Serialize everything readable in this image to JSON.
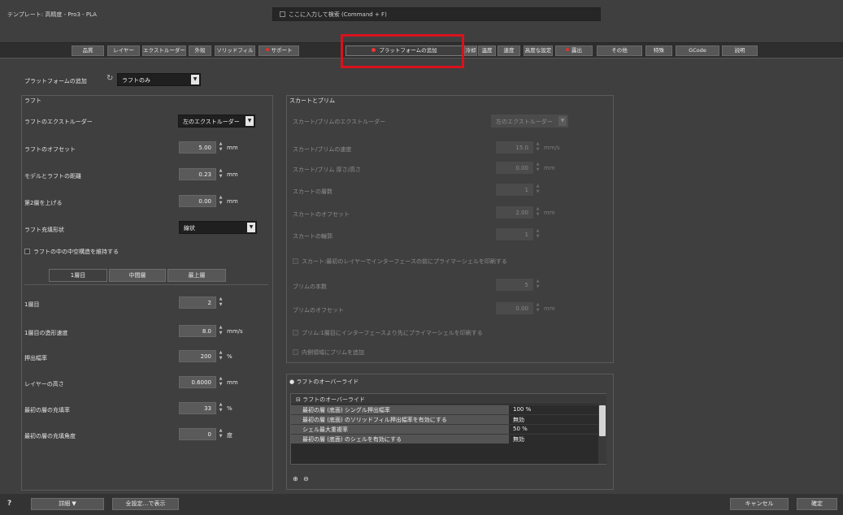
{
  "window": {
    "title": "テンプレート: 高精度 - Pro3 - PLA",
    "search_placeholder": "ここに入力して検索 (Command + F)"
  },
  "tabs": [
    {
      "label": "品質",
      "warn": false,
      "active": false
    },
    {
      "label": "レイヤー",
      "warn": false,
      "active": false
    },
    {
      "label": "エクストルーダー",
      "warn": false,
      "active": false
    },
    {
      "label": "外殻",
      "warn": false,
      "active": false
    },
    {
      "label": "ソリッドフィル",
      "warn": false,
      "active": false
    },
    {
      "label": "サポート",
      "warn": true,
      "active": false
    },
    {
      "label": "プラットフォームの追加",
      "warn": false,
      "active": true
    },
    {
      "label": "冷却",
      "warn": false,
      "active": false
    },
    {
      "label": "温度",
      "warn": false,
      "active": false
    },
    {
      "label": "速度",
      "warn": false,
      "active": false
    },
    {
      "label": "高度な設定",
      "warn": false,
      "active": false
    },
    {
      "label": "露出",
      "warn": true,
      "active": false
    },
    {
      "label": "その他",
      "warn": false,
      "active": false
    },
    {
      "label": "特殊",
      "warn": false,
      "active": false
    },
    {
      "label": "GCode",
      "warn": false,
      "active": false
    },
    {
      "label": "説明",
      "warn": false,
      "active": false
    }
  ],
  "platform": {
    "label": "プラットフォームの追加",
    "value": "ラフトのみ"
  },
  "raft": {
    "group_title": "ラフト",
    "extruder_label": "ラフトのエクストルーダー",
    "extruder_value": "左のエクストルーダー",
    "offset_label": "ラフトのオフセット",
    "offset_value": "5.00",
    "offset_unit": "mm",
    "separation_label": "モデルとラフトの距離",
    "separation_value": "0.23",
    "separation_unit": "mm",
    "raise_label": "第2層を上げる",
    "raise_value": "0.00",
    "raise_unit": "mm",
    "infill_label": "ラフト充填形状",
    "infill_value": "線状",
    "checkbox_label": "ラフトの中の中空構造を維持する",
    "subtabs": [
      "1層目",
      "中間層",
      "最上層"
    ],
    "layer1_label": "1層目",
    "layer1_value": "2",
    "speed_label": "1層目の造形速度",
    "speed_value": "8.0",
    "speed_unit": "mm/s",
    "extrusion_label": "押出幅率",
    "extrusion_value": "200",
    "extrusion_unit": "%",
    "height_label": "レイヤーの高さ",
    "height_value": "0.6000",
    "height_unit": "mm",
    "infill_pct_label": "最初の層の充填率",
    "infill_pct_value": "33",
    "infill_pct_unit": "%",
    "infill_angle_label": "最初の層の充填角度",
    "infill_angle_value": "0",
    "infill_angle_unit": "度"
  },
  "skirt": {
    "group_title": "スカートとブリム",
    "extruder_label": "スカート/ブリムのエクストルーダー",
    "extruder_value": "左のエクストルーダー",
    "speed_label": "スカート/ブリムの速度",
    "speed_value": "15.0",
    "speed_unit": "mm/s",
    "height_label": "スカート/ブリム 厚さ/高さ",
    "height_value": "0.00",
    "height_unit": "mm",
    "layers_label": "スカートの層数",
    "layers_value": "1",
    "offset_label": "スカートのオフセット",
    "offset_value": "2.00",
    "offset_unit": "mm",
    "outlines_label": "スカートの輪郭",
    "outlines_value": "1",
    "check1_label": "スカート:最初のレイヤーでインターフェースの前にプライマーシェルを印刷する",
    "brim_width_label": "ブリムの本数",
    "brim_width_value": "5",
    "brim_offset_label": "ブリムのオフセット",
    "brim_offset_value": "0.00",
    "brim_offset_unit": "mm",
    "check2_label": "ブリム:1層目にインターフェースより先にプライマーシェルを印刷する",
    "check3_label": "内側領域にブリムを追加"
  },
  "override": {
    "group_title": "ラフトのオーバーライド",
    "table_header": "ラフトのオーバーライド",
    "rows": [
      {
        "key": "最初の層 (底面) シングル押出幅率",
        "value": "100 %"
      },
      {
        "key": "最初の層 (底面) のソリッドフィル押出幅率を有効にする",
        "value": "無効"
      },
      {
        "key": "シェル最大重複率",
        "value": "50 %"
      },
      {
        "key": "最初の層 (底面) のシェルを有効にする",
        "value": "無効"
      }
    ],
    "add": "⊕",
    "remove": "⊖"
  },
  "bottom": {
    "help": "?",
    "basic_mode": "詳細",
    "select_all": "全設定…で表示",
    "cancel": "キャンセル",
    "ok": "確定"
  },
  "colors": {
    "highlight": "#d9121c",
    "warn_dot": "#dd3333"
  }
}
